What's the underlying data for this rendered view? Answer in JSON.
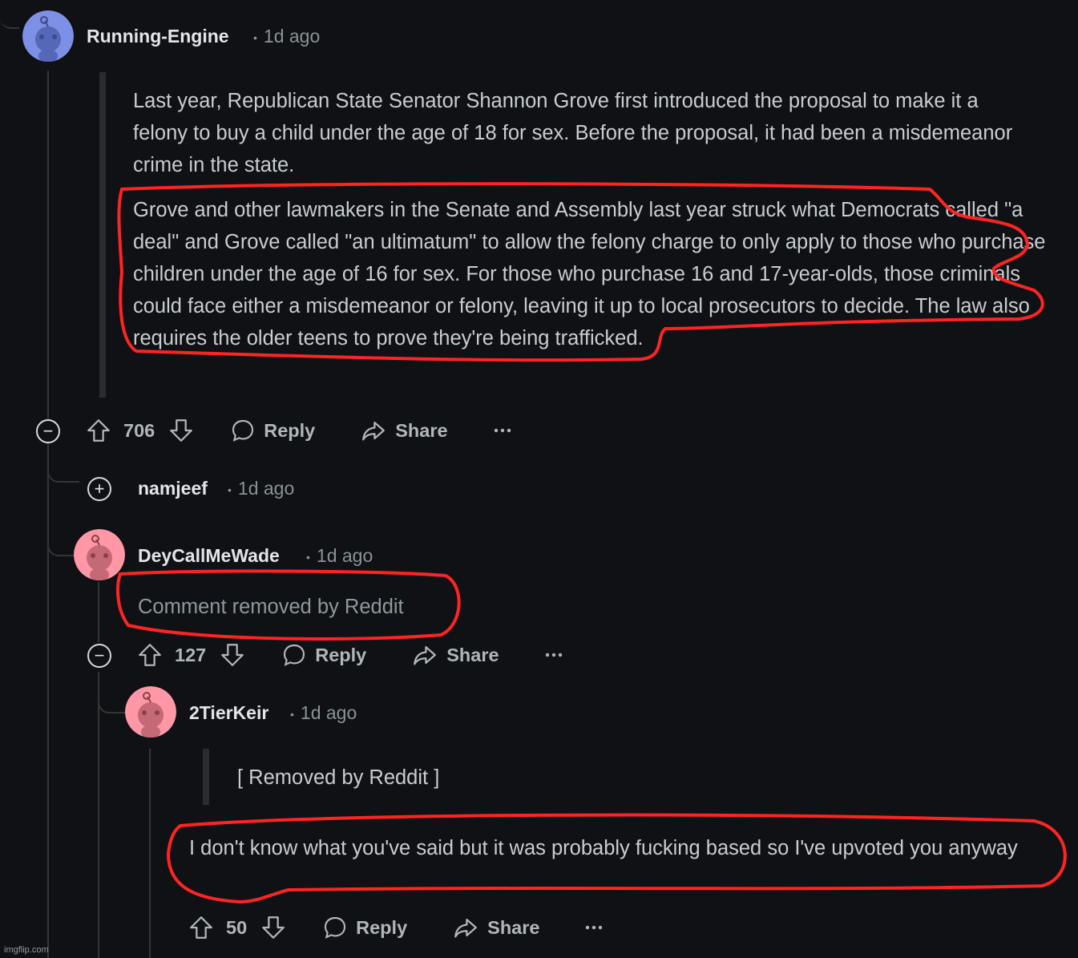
{
  "colors": {
    "background": "#0f1114",
    "thread_line": "#343536",
    "annotation_red": "#ff2424",
    "avatar_blue": "#6b7fd6",
    "avatar_pink": "#ff8b9b"
  },
  "comments": [
    {
      "username": "Running-Engine",
      "time": "1d ago",
      "avatar_color": "blue",
      "paragraphs": [
        "Last year, Republican State Senator Shannon Grove first introduced the proposal to make it a felony to buy a child under the age of 18 for sex. Before the proposal, it had been a misdemeanor crime in the state.",
        "Grove and other lawmakers in the Senate and Assembly last year struck what Democrats called \"a deal\" and Grove called \"an ultimatum\" to allow the felony charge to only apply to those who purchase children under the age of 16 for sex. For those who purchase 16 and 17-year-olds, those criminals could face either a misdemeanor or felony, leaving it up to local prosecutors to decide. The law also requires the older teens to prove they're being trafficked."
      ],
      "score": "706",
      "reply_label": "Reply",
      "share_label": "Share",
      "collapse_symbol": "−"
    },
    {
      "username": "namjeef",
      "time": "1d ago",
      "expand_symbol": "+"
    },
    {
      "username": "DeyCallMeWade",
      "time": "1d ago",
      "avatar_color": "pink",
      "body": "Comment removed by Reddit",
      "score": "127",
      "reply_label": "Reply",
      "share_label": "Share",
      "collapse_symbol": "−"
    },
    {
      "username": "2TierKeir",
      "time": "1d ago",
      "avatar_color": "pink",
      "quote": "[ Removed by Reddit ]",
      "body": "I don't know what you've said but it was probably fucking based so I've upvoted you anyway",
      "score": "50",
      "reply_label": "Reply",
      "share_label": "Share"
    }
  ],
  "more_icon": "more-options-icon",
  "watermark": "imgflip.com"
}
